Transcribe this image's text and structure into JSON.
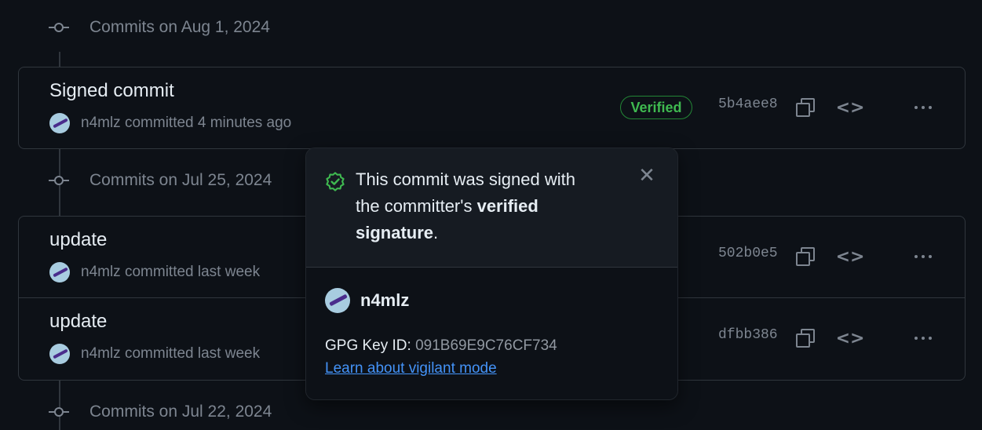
{
  "timeline": [
    {
      "date": "Commits on Aug 1, 2024",
      "commits": [
        {
          "message": "Signed commit",
          "author": "n4mlz",
          "time": "committed 4 minutes ago",
          "badge": "Verified",
          "sha": "5b4aee8"
        }
      ]
    },
    {
      "date": "Commits on Jul 25, 2024",
      "commits": [
        {
          "message": "update",
          "author": "n4mlz",
          "time": "committed last week",
          "sha": "502b0e5"
        },
        {
          "message": "update",
          "author": "n4mlz",
          "time": "committed last week",
          "sha": "dfbb386"
        }
      ]
    },
    {
      "date": "Commits on Jul 22, 2024",
      "commits": []
    }
  ],
  "popover": {
    "title_part1": "This commit was signed with the committer's ",
    "title_bold": "verified signature",
    "title_end": ".",
    "signer": "n4mlz",
    "gpg_label": "GPG Key ID: ",
    "gpg_value": "091B69E9C76CF734",
    "learn_link": "Learn about vigilant mode",
    "close_icon": "x-icon"
  },
  "icons": {
    "commit": "git-commit-icon",
    "copy": "copy-icon",
    "browse": "code-icon",
    "more": "kebab-horizontal-icon",
    "verified": "verified-shield-icon"
  },
  "colors": {
    "background": "#0d1117",
    "verified": "#3fb950",
    "link": "#4493f8",
    "muted": "#7d8590"
  }
}
